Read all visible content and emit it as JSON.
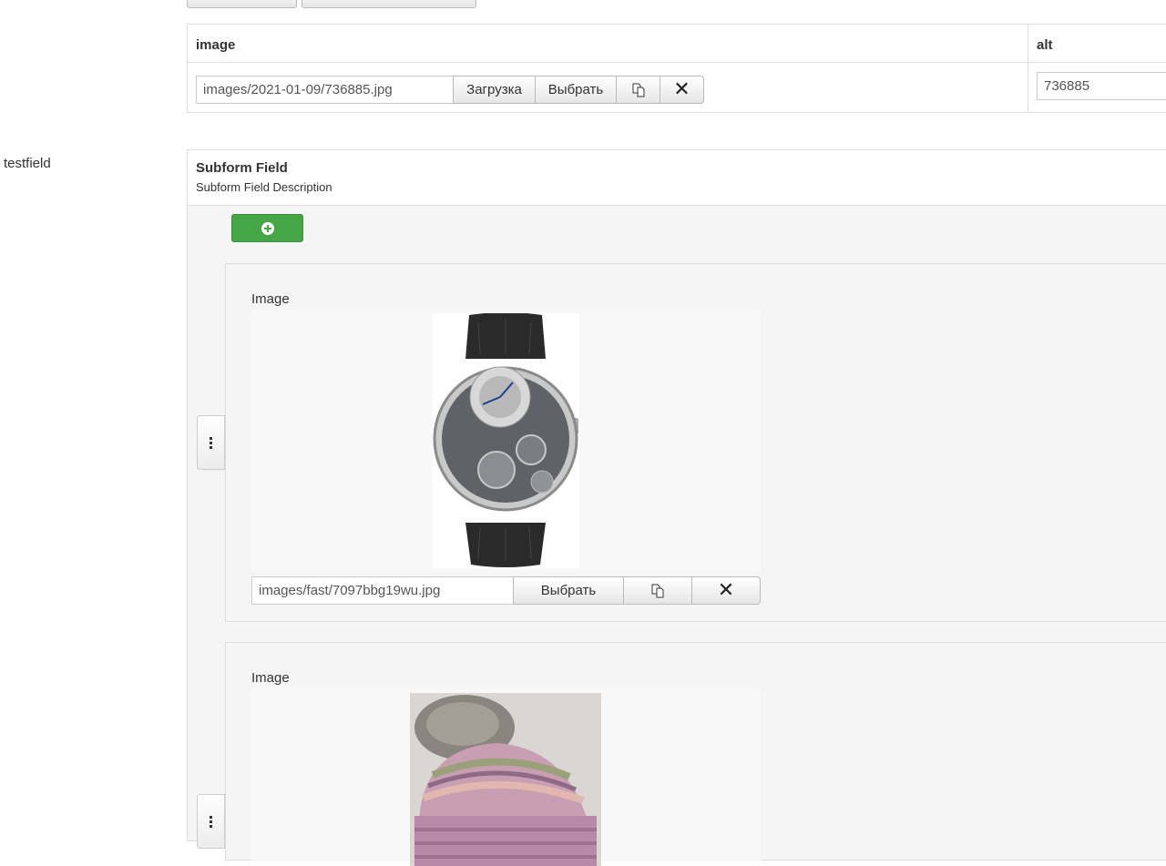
{
  "table": {
    "headers": [
      "image",
      "alt"
    ],
    "row": {
      "image_path": "images/2021-01-09/736885.jpg",
      "upload_label": "Загрузка",
      "select_label": "Выбрать",
      "alt_value": "736885"
    }
  },
  "field": {
    "label": "testfield"
  },
  "subform": {
    "title": "Subform Field",
    "description": "Subform Field Description",
    "rows": [
      {
        "image_label": "Image",
        "image_path": "images/fast/7097bbg19wu.jpg",
        "select_label": "Выбрать",
        "preview": "watch"
      },
      {
        "image_label": "Image",
        "preview": "knit-hat"
      }
    ]
  },
  "colors": {
    "add_button": "#46a546",
    "border": "#dddddd",
    "panel_bg": "#f5f5f5"
  }
}
